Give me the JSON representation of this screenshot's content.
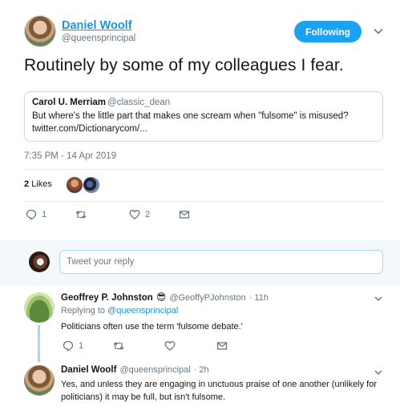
{
  "tweet": {
    "author_name": "Daniel Woolf",
    "author_handle": "@queensprincipal",
    "follow_label": "Following",
    "text": "Routinely by some of my colleagues I fear.",
    "quote": {
      "name": "Carol U. Merriam",
      "handle": "@classic_dean",
      "line1": "But where's the little part that makes one scream when \"fulsome\" is misused?",
      "line2": "twitter.com/Dictionarycom/..."
    },
    "timestamp": "7:35 PM - 14 Apr 2019",
    "likes_number": "2",
    "likes_label": "Likes",
    "actions": {
      "reply_count": "1",
      "retweet_count": "",
      "like_count": "2"
    }
  },
  "reply_box": {
    "placeholder": "Tweet your reply"
  },
  "replies": [
    {
      "name": "Geoffrey P. Johnston",
      "emoji": "😎",
      "handle": "@GeoffyPJohnston",
      "time": "· 11h",
      "replying_prefix": "Replying to",
      "replying_to": "@queensprincipal",
      "text": "Politicians often use the term 'fulsome debate.'",
      "reply_count": "1"
    },
    {
      "name": "Daniel Woolf",
      "handle": "@queensprincipal",
      "time": "· 2h",
      "text_line1": "Yes, and unless they are engaging in unctuous praise of one another (unlikely for",
      "text_line2": "politicians) it may be full, but isn't fulsome."
    }
  ],
  "colors": {
    "accent": "#1da1f2",
    "link": "#1b95e0",
    "muted": "#657786",
    "thread": "#a4d9f9"
  },
  "icons": [
    "caret-down-icon",
    "reply-icon",
    "retweet-icon",
    "heart-icon",
    "message-icon"
  ]
}
